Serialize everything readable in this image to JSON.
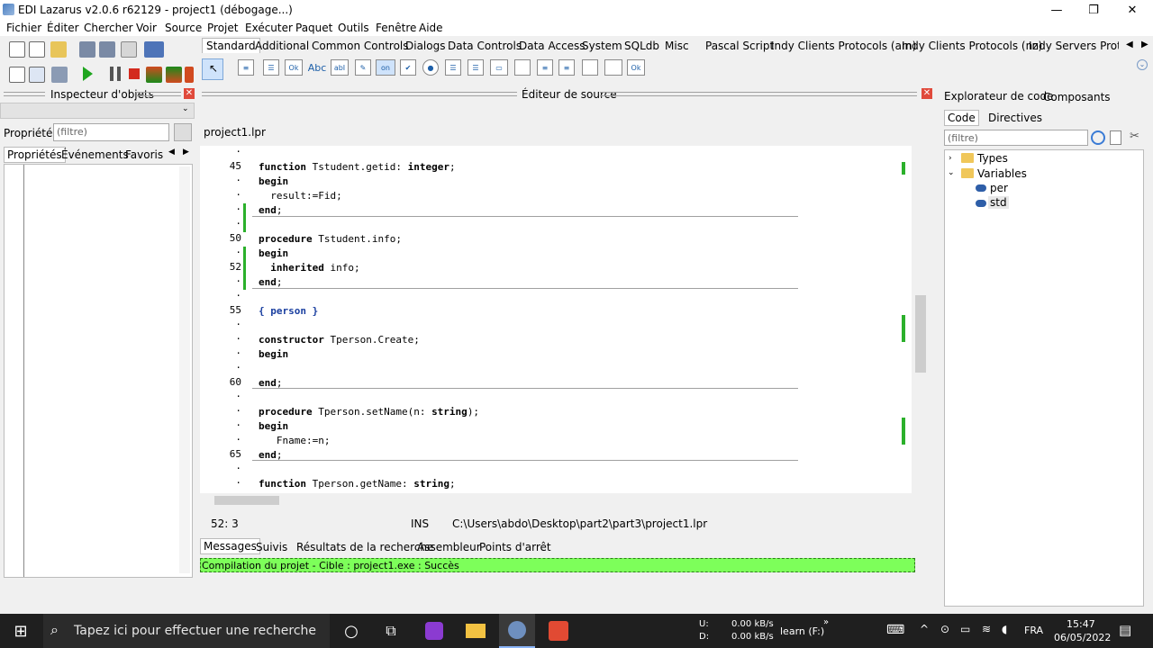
{
  "window": {
    "title": "EDI Lazarus v2.0.6 r62129 - project1 (débogage...)",
    "minimize": "—",
    "maximize": "❐",
    "close": "✕"
  },
  "menu": [
    "Fichier",
    "Éditer",
    "Chercher",
    "Voir",
    "Source",
    "Projet",
    "Exécuter",
    "Paquet",
    "Outils",
    "Fenêtre",
    "Aide"
  ],
  "palette_tabs": [
    "Standard",
    "Additional",
    "Common Controls",
    "Dialogs",
    "Data Controls",
    "Data Access",
    "System",
    "SQLdb",
    "Misc",
    "Pascal Script",
    "Indy Clients Protocols (am)",
    "Indy Clients Protocols (nz)",
    "Indy Servers Protoco"
  ],
  "inspector": {
    "title": "Inspecteur d'objets",
    "props_label": "Propriétés",
    "filter_placeholder": "(filtre)",
    "tabs": [
      "Propriétés",
      "Événements",
      "Favoris"
    ]
  },
  "editor": {
    "title": "Éditeur de source",
    "file_tab": "project1.lpr",
    "lines": [
      {
        "n": "·",
        "code": ""
      },
      {
        "n": "45",
        "code": "function Tstudent.getid: integer;"
      },
      {
        "n": "·",
        "code": "begin"
      },
      {
        "n": "·",
        "code": "  result:=Fid;"
      },
      {
        "n": "·",
        "code": "end;"
      },
      {
        "n": "·",
        "code": ""
      },
      {
        "n": "50",
        "code": "procedure Tstudent.info;"
      },
      {
        "n": "·",
        "code": "begin"
      },
      {
        "n": "52",
        "code": "  inherited info;"
      },
      {
        "n": "·",
        "code": "end;"
      },
      {
        "n": "·",
        "code": ""
      },
      {
        "n": "55",
        "code": "{ person }"
      },
      {
        "n": "·",
        "code": ""
      },
      {
        "n": "·",
        "code": "constructor Tperson.Create;"
      },
      {
        "n": "·",
        "code": "begin"
      },
      {
        "n": "·",
        "code": ""
      },
      {
        "n": "60",
        "code": "end;"
      },
      {
        "n": "·",
        "code": ""
      },
      {
        "n": "·",
        "code": "procedure Tperson.setName(n: string);"
      },
      {
        "n": "·",
        "code": "begin"
      },
      {
        "n": "·",
        "code": "   Fname:=n;"
      },
      {
        "n": "65",
        "code": "end;"
      },
      {
        "n": "·",
        "code": ""
      },
      {
        "n": "·",
        "code": "function Tperson.getName: string;"
      }
    ]
  },
  "status": {
    "pos": "52: 3",
    "mode": "INS",
    "path": "C:\\Users\\abdo\\Desktop\\part2\\part3\\project1.lpr"
  },
  "messages": {
    "tabs": [
      "Messages",
      "Suivis",
      "Résultats de la recherche",
      "Assembleur",
      "Points d'arrêt"
    ],
    "line": "Compilation du projet - Cible : project1.exe : Succès",
    "success_color": "#7dff5a"
  },
  "explorer": {
    "tabs": [
      "Explorateur de code",
      "Composants"
    ],
    "subtabs": [
      "Code",
      "Directives"
    ],
    "filter_placeholder": "(filtre)",
    "tree": [
      {
        "label": "Types",
        "level": 0
      },
      {
        "label": "Variables",
        "level": 0
      },
      {
        "label": "per",
        "level": 1
      },
      {
        "label": "std",
        "level": 1
      }
    ]
  },
  "taskbar": {
    "search_placeholder": "Tapez ici pour effectuer une recherche",
    "net_u_label": "U:",
    "net_d_label": "D:",
    "net_u": "0.00 kB/s",
    "net_d": "0.00 kB/s",
    "drive": "learn (F:)",
    "lang": "FRA",
    "time": "15:47",
    "date": "06/05/2022"
  }
}
